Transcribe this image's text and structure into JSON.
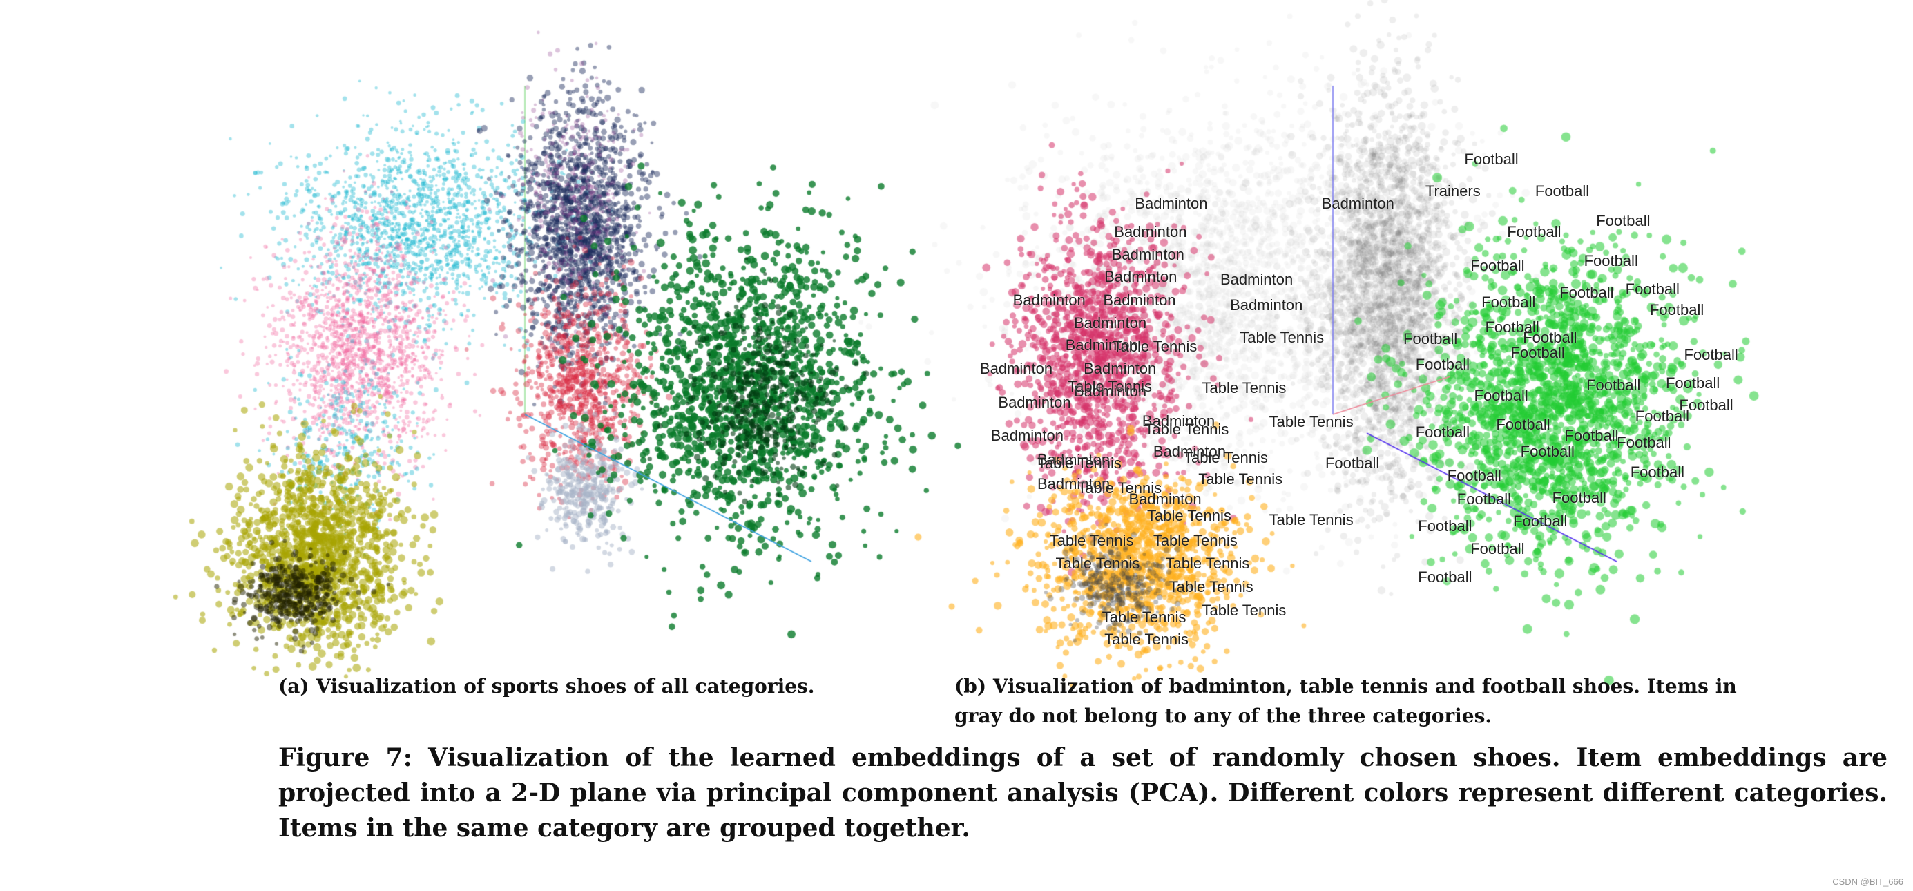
{
  "panel_a": {
    "caption": "(a) Visualization of sports shoes of all categories.",
    "cluster_colors": [
      "#19b7cf",
      "#f0609a",
      "#a8a400",
      "#1a2a5a",
      "#d8203a",
      "#a8b4c8",
      "#0a7a2a"
    ]
  },
  "panel_b": {
    "caption_line1": "(b) Visualization of badminton, table tennis and football shoes. Items in",
    "caption_line2": "gray do not belong to any of the three categories.",
    "label_texts": [
      "Badminton",
      "Table Tennis",
      "Football",
      "Trainers"
    ],
    "cluster_colors": {
      "badminton": "#d6336a",
      "table_tennis": "#ffb020",
      "football": "#22cc33",
      "other": "#555555"
    }
  },
  "figure_caption": "Figure 7: Visualization of the learned embeddings of a set of randomly chosen shoes. Item embeddings are projected into a 2-D plane via principal component analysis (PCA). Different colors represent different categories. Items in the same category are grouped together.",
  "watermark": "CSDN @BIT_666"
}
